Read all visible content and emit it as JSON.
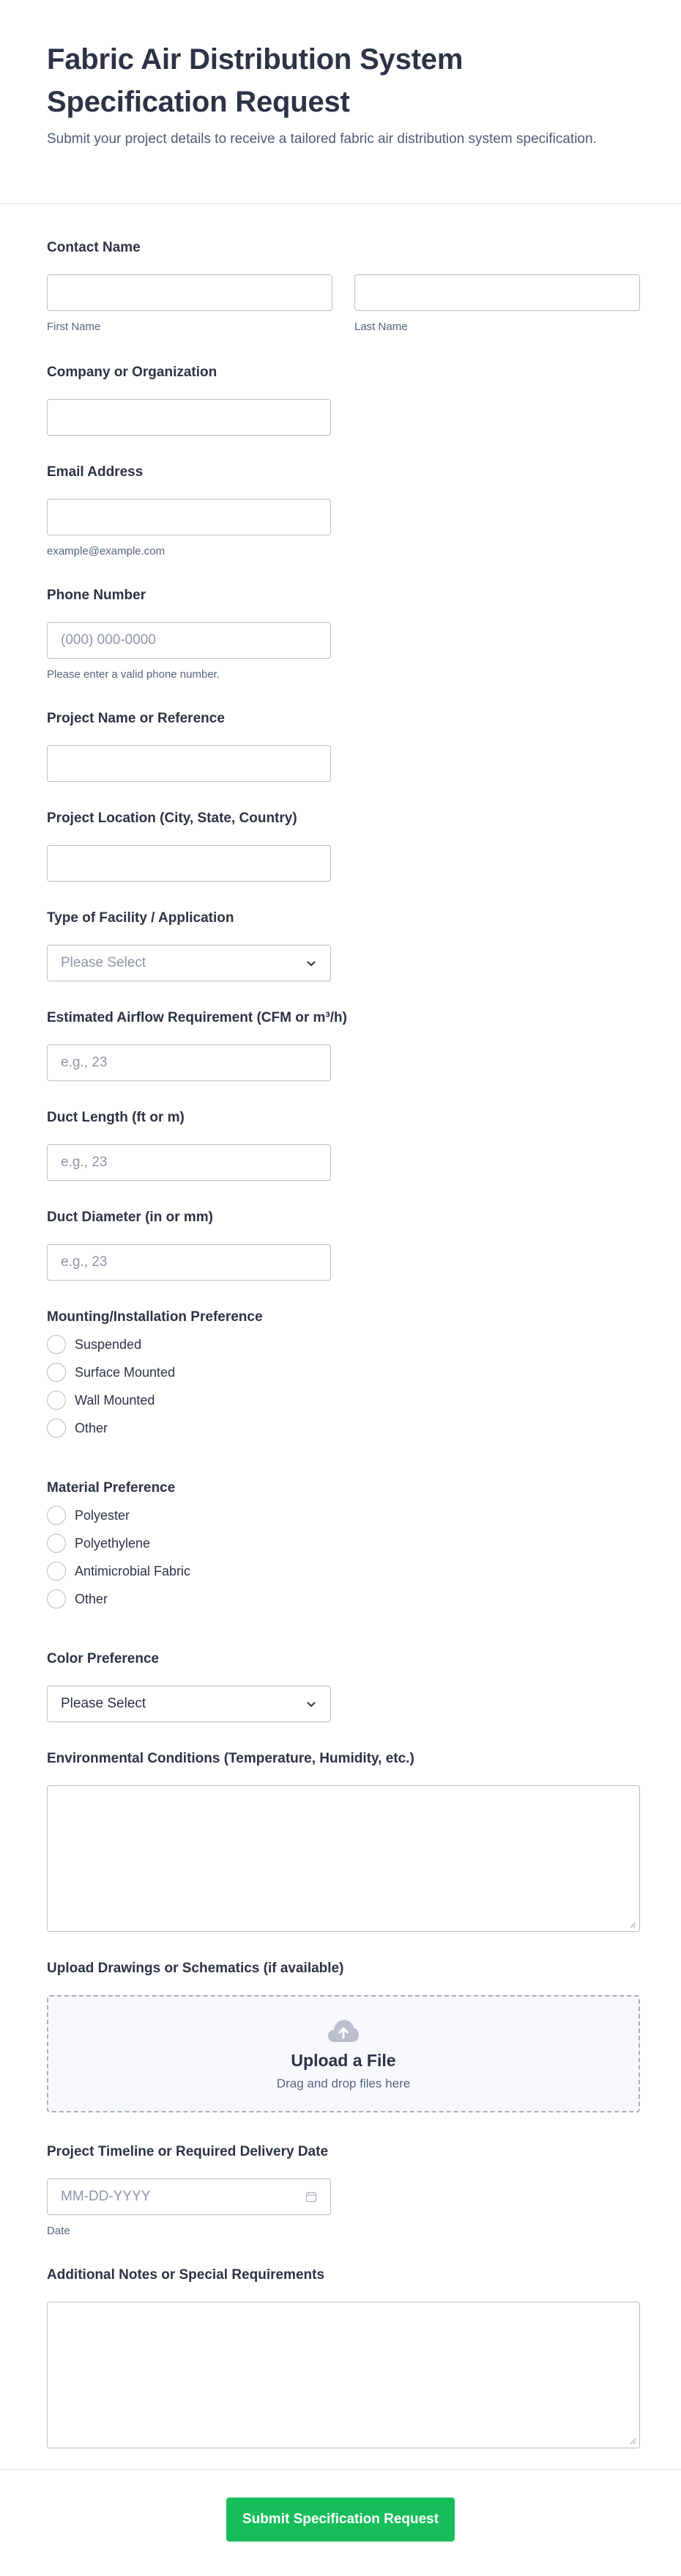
{
  "header": {
    "title": "Fabric Air Distribution System Specification Request",
    "subtitle": "Submit your project details to receive a tailored fabric air distribution system specification."
  },
  "contact": {
    "label": "Contact Name",
    "first_sub": "First Name",
    "last_sub": "Last Name"
  },
  "company": {
    "label": "Company or Organization"
  },
  "email": {
    "label": "Email Address",
    "sub": "example@example.com"
  },
  "phone": {
    "label": "Phone Number",
    "placeholder": "(000) 000-0000",
    "sub": "Please enter a valid phone number."
  },
  "project_name": {
    "label": "Project Name or Reference"
  },
  "project_location": {
    "label": "Project Location (City, State, Country)"
  },
  "facility_type": {
    "label": "Type of Facility / Application",
    "placeholder": "Please Select"
  },
  "airflow": {
    "label": "Estimated Airflow Requirement (CFM or m³/h)",
    "placeholder": "e.g., 23"
  },
  "duct_length": {
    "label": "Duct Length (ft or m)",
    "placeholder": "e.g., 23"
  },
  "duct_diameter": {
    "label": "Duct Diameter (in or mm)",
    "placeholder": "e.g., 23"
  },
  "mounting": {
    "label": "Mounting/Installation Preference",
    "options": [
      "Suspended",
      "Surface Mounted",
      "Wall Mounted",
      "Other"
    ]
  },
  "material": {
    "label": "Material Preference",
    "options": [
      "Polyester",
      "Polyethylene",
      "Antimicrobial Fabric",
      "Other"
    ]
  },
  "color": {
    "label": "Color Preference",
    "placeholder": "Please Select"
  },
  "environment": {
    "label": "Environmental Conditions (Temperature, Humidity, etc.)"
  },
  "upload": {
    "label": "Upload Drawings or Schematics (if available)",
    "title": "Upload a File",
    "hint": "Drag and drop files here"
  },
  "timeline": {
    "label": "Project Timeline or Required Delivery Date",
    "placeholder": "MM-DD-YYYY",
    "sub": "Date"
  },
  "notes": {
    "label": "Additional Notes or Special Requirements"
  },
  "submit": {
    "label": "Submit Specification Request"
  },
  "colors": {
    "accent": "#18bd5b",
    "border": "#b8bdc9",
    "text": "#2c3345"
  }
}
